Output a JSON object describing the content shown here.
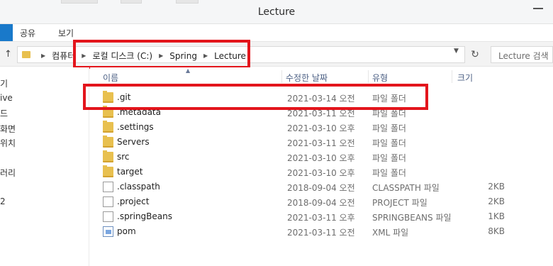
{
  "window": {
    "title": "Lecture"
  },
  "ribbon": {
    "items": [
      "공유",
      "보기"
    ]
  },
  "address": {
    "crumbs": [
      "컴퓨터",
      "로컬 디스크 (C:)",
      "Spring",
      "Lecture"
    ],
    "search_placeholder": "Lecture 검색"
  },
  "nav": {
    "items": [
      "기",
      "ive",
      "드",
      "화면",
      "위치",
      "러리",
      "2"
    ]
  },
  "columns": {
    "name": "이름",
    "modified": "수정한 날짜",
    "type": "유형",
    "size": "크기"
  },
  "files": [
    {
      "name": ".git",
      "date": "2021-03-14 오전...",
      "type": "파일 폴더",
      "size": "",
      "icon": "folder-icon"
    },
    {
      "name": ".metadata",
      "date": "2021-03-11 오전...",
      "type": "파일 폴더",
      "size": "",
      "icon": "folder-icon"
    },
    {
      "name": ".settings",
      "date": "2021-03-10 오후...",
      "type": "파일 폴더",
      "size": "",
      "icon": "folder-icon"
    },
    {
      "name": "Servers",
      "date": "2021-03-11 오전...",
      "type": "파일 폴더",
      "size": "",
      "icon": "folder-icon"
    },
    {
      "name": "src",
      "date": "2021-03-10 오후...",
      "type": "파일 폴더",
      "size": "",
      "icon": "folder-icon"
    },
    {
      "name": "target",
      "date": "2021-03-10 오후...",
      "type": "파일 폴더",
      "size": "",
      "icon": "folder-icon"
    },
    {
      "name": ".classpath",
      "date": "2018-09-04 오전...",
      "type": "CLASSPATH 파일",
      "size": "2KB",
      "icon": "file-icon"
    },
    {
      "name": ".project",
      "date": "2018-09-04 오전...",
      "type": "PROJECT 파일",
      "size": "2KB",
      "icon": "file-icon"
    },
    {
      "name": ".springBeans",
      "date": "2021-03-11 오후...",
      "type": "SPRINGBEANS 파일",
      "size": "1KB",
      "icon": "file-icon"
    },
    {
      "name": "pom",
      "date": "2021-03-11 오전...",
      "type": "XML 파일",
      "size": "8KB",
      "icon": "xml-file-icon"
    }
  ],
  "colors": {
    "annotation": "#e3151c",
    "folder": "#e8c04f",
    "header_text": "#4d6185"
  }
}
